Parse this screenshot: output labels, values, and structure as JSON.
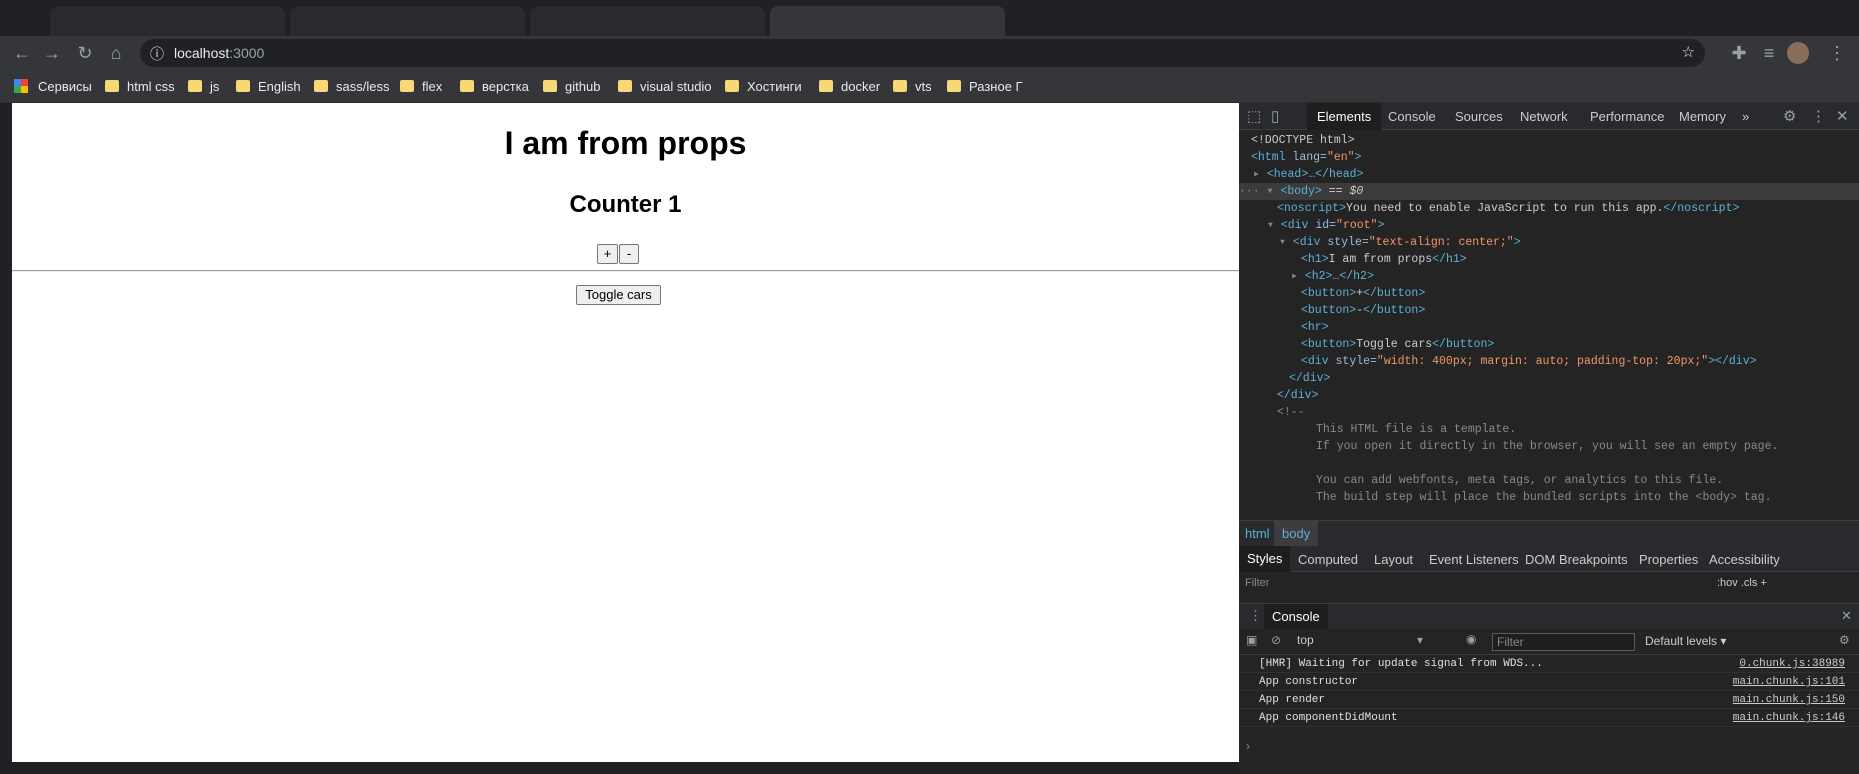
{
  "browser": {
    "url_host": "localhost",
    "url_port": ":3000",
    "bookmarks": [
      "Сервисы",
      "html css",
      "js",
      "English",
      "sass/less",
      "flex",
      "верстка",
      "github",
      "visual studio",
      "Хостинги",
      "docker",
      "vts",
      "Разное Г"
    ]
  },
  "page": {
    "h1": "I am from props",
    "h2": "Counter 1",
    "plus_label": "+",
    "minus_label": "-",
    "toggle_label": "Toggle cars"
  },
  "devtools": {
    "tabs": [
      "Elements",
      "Console",
      "Sources",
      "Network",
      "Performance",
      "Memory"
    ],
    "more": "»",
    "breadcrumbs": [
      "html",
      "body"
    ],
    "subtabs": [
      "Styles",
      "Computed",
      "Layout",
      "Event Listeners",
      "DOM Breakpoints",
      "Properties",
      "Accessibility"
    ],
    "styles_filter": "Filter",
    "styles_hov": ":hov  .cls  +",
    "drawer_tab": "Console",
    "console_context": "top",
    "console_filter_placeholder": "Filter",
    "console_levels": "Default levels ▾",
    "console_messages": [
      {
        "text": "[HMR] Waiting for update signal from WDS...",
        "source": "0.chunk.js:38989"
      },
      {
        "text": "App constructor",
        "source": "main.chunk.js:101"
      },
      {
        "text": "App render",
        "source": "main.chunk.js:150"
      },
      {
        "text": "App componentDidMount",
        "source": "main.chunk.js:146"
      }
    ],
    "console_prompt": "›"
  },
  "dom_tree": {
    "doctype": "<!DOCTYPE html>",
    "html_open": "<html",
    "html_attr": " lang=",
    "html_val": "\"en\"",
    "html_close": ">",
    "head": "<head>…</head>",
    "body": "<body>",
    "body_eq": " == $0",
    "noscript_open": "<noscript>",
    "noscript_text": "You need to enable JavaScript to run this app.",
    "noscript_close": "</noscript>",
    "div_root_open": "<div",
    "div_root_attr": " id=",
    "div_root_val": "\"root\"",
    "div_style_attr": " style=",
    "div_style_val": "\"text-align: center;\"",
    "h1_open": "<h1>",
    "h1_text": "I am from props",
    "h1_close": "</h1>",
    "h2_collapsed": "<h2>…</h2>",
    "btn_open": "<button>",
    "btn_plus": "+",
    "btn_minus": "-",
    "btn_toggle": "Toggle cars",
    "btn_close": "</button>",
    "hr": "<hr>",
    "div_inner_val": "\"width: 400px; margin: auto; padding-top: 20px;\"",
    "div_empty_close": "</div>",
    "div_close": "</div>",
    "comment_open": "<!--",
    "comment_lines": [
      "This HTML file is a template.",
      "If you open it directly in the browser, you will see an empty page.",
      "",
      "You can add webfonts, meta tags, or analytics to this file.",
      "The build step will place the bundled scripts into the <body> tag."
    ]
  }
}
